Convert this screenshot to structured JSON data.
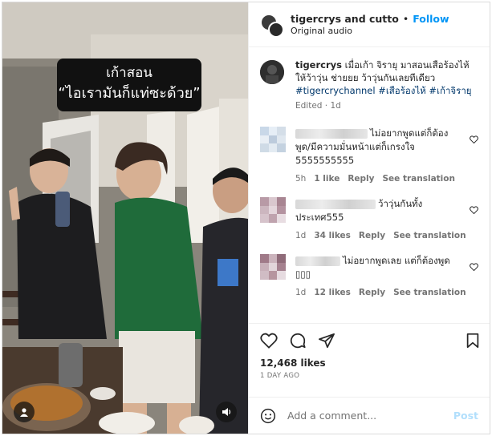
{
  "media": {
    "caption_line1": "เก้าสอน",
    "caption_line2": "“ไอเรามันก็แท่ซะด้วย”"
  },
  "header": {
    "names": "tigercrys and cutto",
    "follow_label": "Follow",
    "audio_label": "Original audio"
  },
  "caption": {
    "username": "tigercrys",
    "text": "เมื่อเก้า จิรายุ มาสอนเสือร้องไห้ ให้ว้าวุ่น ช่ายยย ว้าวุ่นกันเลยทีเดียว",
    "hashtags": "#tigercrychannel #เสือร้องไห้ #เก้าจิรายุ",
    "edited": "Edited",
    "time": "1d"
  },
  "comments": [
    {
      "text": "ไม่อยากพูดแต่ก็ต้องพูด/มีความมั่นหน้าแต่ก็เกรงใจ 5555555555",
      "line_a": "ไม่อยากพูดแต่ก็ต้อง",
      "line_b": "พูด/มีความมั่นหน้าแต่ก็เกรงใจ",
      "line_c": "5555555555",
      "time": "5h",
      "likes": "1 like",
      "reply": "Reply",
      "translate": "See translation",
      "avatar_colors": [
        "#c9d8e8",
        "#e6eef6",
        "#d4dee8",
        "#e9eff5",
        "#bccbdc",
        "#dfe7ef",
        "#cfdbe6",
        "#e3ebf2",
        "#c4d2e0"
      ]
    },
    {
      "line_a": "ว้าวุ่นกันทั้ง",
      "line_b": "ประเทศ555",
      "time": "1d",
      "likes": "34 likes",
      "reply": "Reply",
      "translate": "See translation",
      "avatar_colors": [
        "#b89aa6",
        "#d9c7ce",
        "#a88592",
        "#ccb6bf",
        "#e4d6dc",
        "#b493a0",
        "#d6c3cb",
        "#bfa3ae",
        "#e8dde2"
      ]
    },
    {
      "line_a": "ไม่อยากพูดเลย แต่ก็ต้องพูด",
      "line_b": "▯▯▯",
      "time": "1d",
      "likes": "12 likes",
      "reply": "Reply",
      "translate": "See translation",
      "avatar_colors": [
        "#a07a88",
        "#cbb3bc",
        "#8f6b79",
        "#c8b0b9",
        "#e2d5da",
        "#a5818f",
        "#d0bcc4",
        "#b6959f",
        "#e6dbe0"
      ]
    }
  ],
  "actions": {
    "likes": "12,468 likes",
    "ago": "1 DAY AGO"
  },
  "add_comment": {
    "placeholder": "Add a comment...",
    "post_label": "Post"
  },
  "icons": [
    "user-tag-icon",
    "audio-icon",
    "heart-icon",
    "comment-icon",
    "share-icon",
    "save-icon",
    "emoji-icon"
  ]
}
